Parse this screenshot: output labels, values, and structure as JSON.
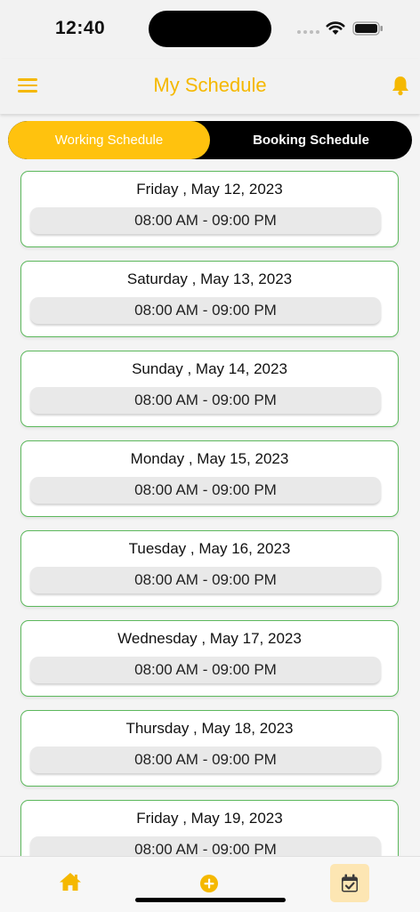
{
  "status_bar": {
    "time": "12:40"
  },
  "header": {
    "title": "My Schedule"
  },
  "tabs": {
    "working": "Working Schedule",
    "booking": "Booking Schedule",
    "active": "working"
  },
  "schedule": [
    {
      "date": "Friday , May 12, 2023",
      "hours": "08:00 AM - 09:00 PM"
    },
    {
      "date": "Saturday , May 13, 2023",
      "hours": "08:00 AM - 09:00 PM"
    },
    {
      "date": "Sunday , May 14, 2023",
      "hours": "08:00 AM - 09:00 PM"
    },
    {
      "date": "Monday , May 15, 2023",
      "hours": "08:00 AM - 09:00 PM"
    },
    {
      "date": "Tuesday , May 16, 2023",
      "hours": "08:00 AM - 09:00 PM"
    },
    {
      "date": "Wednesday , May 17, 2023",
      "hours": "08:00 AM - 09:00 PM"
    },
    {
      "date": "Thursday , May 18, 2023",
      "hours": "08:00 AM - 09:00 PM"
    },
    {
      "date": "Friday , May 19, 2023",
      "hours": "08:00 AM - 09:00 PM"
    }
  ],
  "bottom_nav": {
    "items": [
      "home-icon",
      "add-circle-icon",
      "calendar-check-icon"
    ],
    "active": "calendar-check-icon"
  },
  "colors": {
    "accent": "#ffc20e",
    "card_border": "#5cb85c",
    "tab_bar": "#000000"
  }
}
